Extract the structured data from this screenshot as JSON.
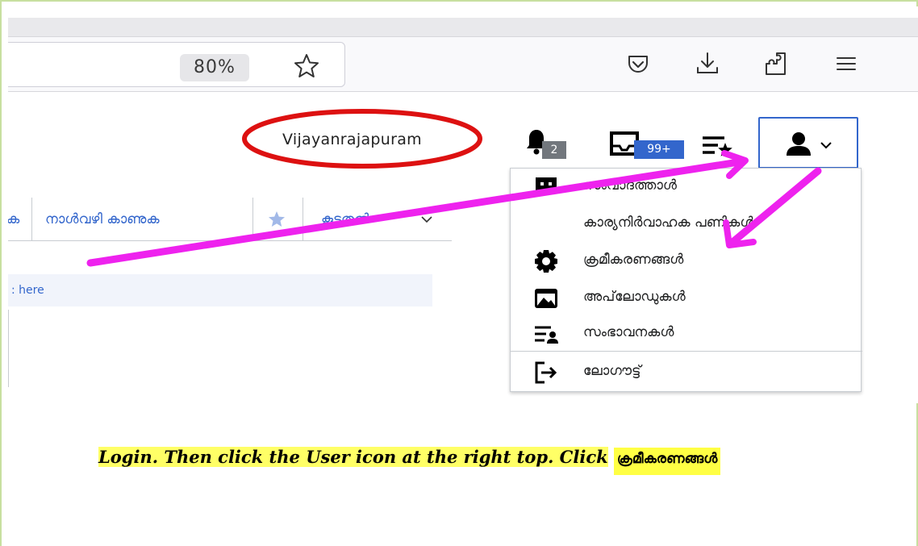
{
  "browser": {
    "zoom_level": "80%",
    "icons": [
      "bookmark-star-icon",
      "pocket-icon",
      "downloads-icon",
      "extensions-icon",
      "menu-icon"
    ]
  },
  "header": {
    "username": "Vijayanrajapuram",
    "notifications_count": "2",
    "messages_count": "99+",
    "icons": [
      "bell-icon",
      "inbox-icon",
      "watchlist-icon",
      "user-icon"
    ]
  },
  "nav": {
    "tabs": [
      "ക",
      "നാൾവഴി കാണുക",
      "കൂടുതൽ"
    ],
    "notice_text": ": here"
  },
  "user_menu": {
    "items": [
      {
        "label": "സംവാദത്താൾ",
        "icon": "talk-icon"
      },
      {
        "label": "കാര്യനിർവാഹക പണികൾ",
        "icon": ""
      },
      {
        "label": "ക്രമീകരണങ്ങൾ",
        "icon": "gear-icon"
      },
      {
        "label": "അപ്‌ലോഡുകൾ",
        "icon": "image-icon"
      },
      {
        "label": "സംഭാവനകൾ",
        "icon": "contributions-icon"
      },
      {
        "label": "ലോഗൗട്ട്",
        "icon": "logout-icon"
      }
    ]
  },
  "caption": {
    "text": "Login. Then click the User icon at the right top. Click",
    "highlight": "ക്രമീകരണങ്ങൾ"
  },
  "colors": {
    "annotation_arrow": "#ee22ee",
    "circle": "#dd1111",
    "accent": "#3366cc",
    "highlight": "#ffff66"
  }
}
